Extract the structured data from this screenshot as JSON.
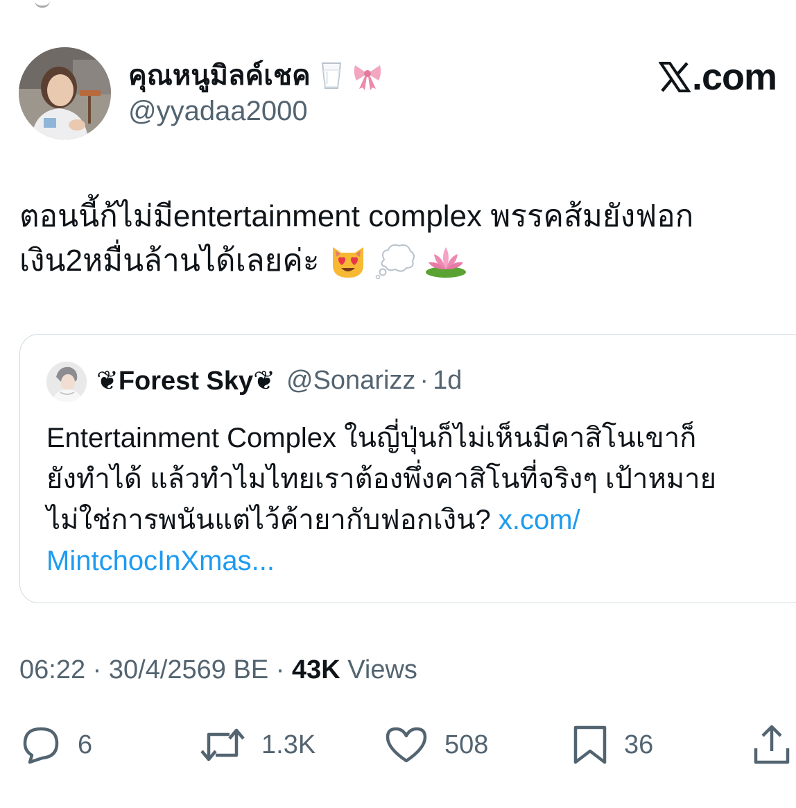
{
  "author": {
    "display_name": "คุณหนูมิลค์เชค",
    "name_emojis": [
      "milk-glass-emoji",
      "ribbon-emoji"
    ],
    "handle": "@yyadaa2000"
  },
  "brand": {
    "label": ".com",
    "logo_icon": "x-logo-icon"
  },
  "tweet": {
    "line1": "ตอนนี้ก้ไม่มีentertainment complex พรรคส้มยังฟอก",
    "line2": "เงิน2หมื่นล้านได้เลยค่ะ",
    "emojis": [
      "heart-eyes-cat-emoji",
      "thought-balloon-emoji",
      "lotus-emoji"
    ]
  },
  "quote": {
    "name": "Forest Sky",
    "name_decoration": "❦",
    "handle": "@Sonarizz",
    "separator": "·",
    "time": "1d",
    "line1": "Entertainment Complex ในญี่ปุ่นก็ไม่เห็นมีคาสิโนเขาก็",
    "line2": "ยังทำได้ แล้วทำไมไทยเราต้องพึ่งคาสิโนที่จริงๆ เป้าหมาย",
    "line3_text": "ไม่ใช่การพนันแต่ไว้ค้ายากับฟอกเงิน? ",
    "line3_link": "x.com/",
    "line4_link": "MintchocInXmas..."
  },
  "meta": {
    "time": "06:22",
    "sep1": " · ",
    "date": "30/4/2569 BE",
    "sep2": " · ",
    "views_count": "43K",
    "views_label": " Views"
  },
  "actions": {
    "replies": "6",
    "reposts": "1.3K",
    "likes": "508",
    "bookmarks": "36"
  },
  "colors": {
    "text": "#0f1419",
    "secondary": "#536471",
    "link": "#1d9bf0",
    "border": "#cfd9de"
  }
}
